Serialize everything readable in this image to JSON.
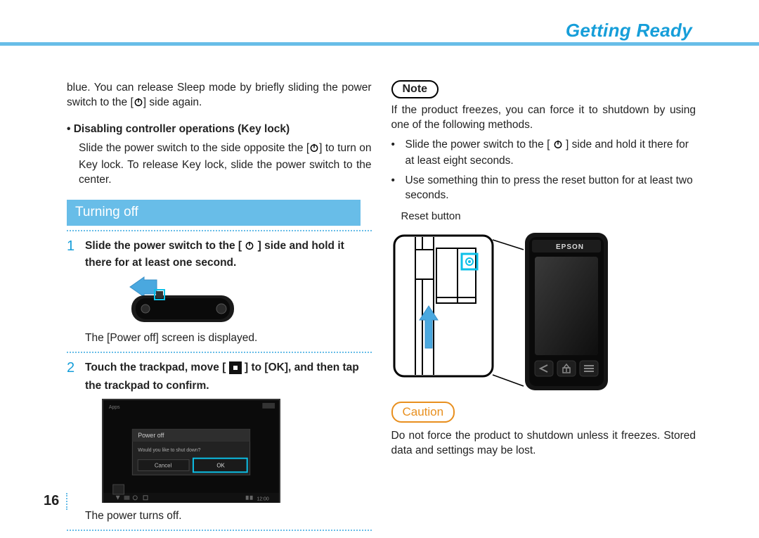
{
  "header": {
    "section_title": "Getting Ready"
  },
  "page_number": "16",
  "leftCol": {
    "intro": "blue. You can release Sleep mode by briefly sliding the power switch to the [   ] side again.",
    "keylock_heading": "Disabling controller operations (Key lock)",
    "keylock_body": "Slide the power switch to the side opposite the [   ] to turn on Key lock. To release Key lock, slide the power switch to the center.",
    "section_bar": "Turning off",
    "step1_num": "1",
    "step1_main": "Slide the power switch to the [   ] side and hold it there for at least one second.",
    "step1_after": "The [Power off] screen is displayed.",
    "step2_num": "2",
    "step2_main": "Touch the trackpad, move [    ] to [OK], and then tap the trackpad to confirm.",
    "step2_after": "The power turns off.",
    "screenshot": {
      "dialog_title": "Power off",
      "dialog_msg": "Would you like to shut down?",
      "cancel": "Cancel",
      "ok": "OK",
      "clock": "12:00",
      "app_label": "Apps"
    }
  },
  "rightCol": {
    "note_label": "Note",
    "note_intro": "If the product freezes, you can force it to shutdown by using one of the following methods.",
    "note_b1": "Slide the power switch to the [   ] side and hold it there for at least eight seconds.",
    "note_b2": "Use something thin to press the reset button for at least two seconds.",
    "reset_label": "Reset button",
    "device_brand": "EPSON",
    "caution_label": "Caution",
    "caution_body": "Do not force the product to shutdown unless it freezes. Stored data and settings may be lost."
  }
}
